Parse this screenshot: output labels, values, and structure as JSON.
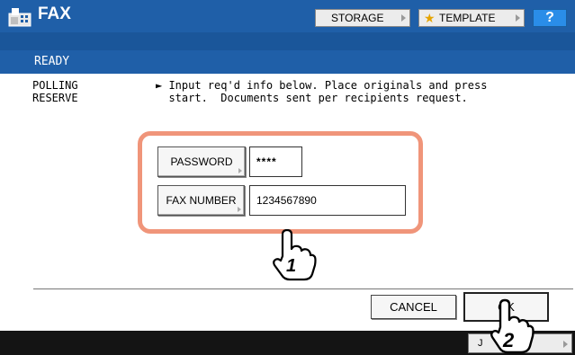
{
  "header": {
    "title": "FAX",
    "storage_label": "STORAGE",
    "template_label": "TEMPLATE",
    "help_label": "?"
  },
  "status": {
    "ready": "READY"
  },
  "mode": {
    "label": "POLLING\nRESERVE"
  },
  "instruction": "► Input req'd info below. Place originals and press\n  start.  Documents sent per recipients request.",
  "fields": {
    "password_label": "PASSWORD",
    "password_value": "****",
    "fax_number_label": "FAX NUMBER",
    "fax_number_value": "1234567890"
  },
  "callouts": {
    "step1": "1",
    "step2": "2"
  },
  "actions": {
    "cancel_label": "CANCEL",
    "ok_label": "OK"
  },
  "footer": {
    "job_status_label": "J        TUS"
  },
  "colors": {
    "header_blue": "#1f5fa8",
    "highlight": "#f0957a",
    "help_blue": "#2a8de8"
  }
}
